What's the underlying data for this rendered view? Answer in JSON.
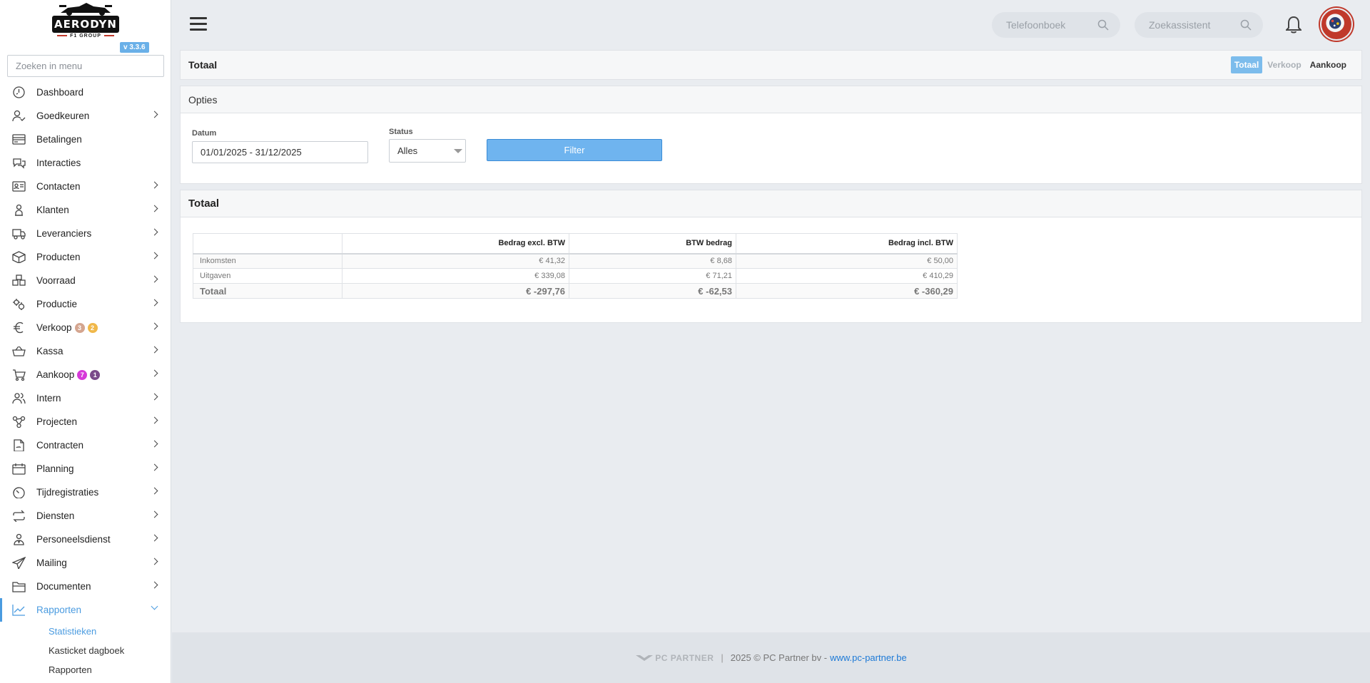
{
  "app": {
    "logo_text": "AERODYN",
    "logo_sub": "F1 GROUP",
    "version": "v 3.3.6"
  },
  "sidebar": {
    "search_placeholder": "Zoeken in menu",
    "items": [
      {
        "label": "Dashboard",
        "icon": "dashboard-icon",
        "chevron": false
      },
      {
        "label": "Goedkeuren",
        "icon": "user-check-icon",
        "chevron": true
      },
      {
        "label": "Betalingen",
        "icon": "credit-card-icon",
        "chevron": false
      },
      {
        "label": "Interacties",
        "icon": "chat-bubbles-icon",
        "chevron": false
      },
      {
        "label": "Contacten",
        "icon": "contact-card-icon",
        "chevron": true
      },
      {
        "label": "Klanten",
        "icon": "person-icon",
        "chevron": true
      },
      {
        "label": "Leveranciers",
        "icon": "truck-icon",
        "chevron": true
      },
      {
        "label": "Producten",
        "icon": "box-icon",
        "chevron": true
      },
      {
        "label": "Voorraad",
        "icon": "boxes-icon",
        "chevron": true
      },
      {
        "label": "Productie",
        "icon": "gears-icon",
        "chevron": true
      },
      {
        "label": "Verkoop",
        "icon": "euro-icon",
        "chevron": true,
        "badges": [
          {
            "value": "3",
            "color": "#d4a58f"
          },
          {
            "value": "2",
            "color": "#f0b84a"
          }
        ]
      },
      {
        "label": "Kassa",
        "icon": "basket-icon",
        "chevron": true
      },
      {
        "label": "Aankoop",
        "icon": "cart-icon",
        "chevron": true,
        "badges": [
          {
            "value": "7",
            "color": "#d63ad9"
          },
          {
            "value": "1",
            "color": "#7a4a8a"
          }
        ]
      },
      {
        "label": "Intern",
        "icon": "users-icon",
        "chevron": true
      },
      {
        "label": "Projecten",
        "icon": "project-nodes-icon",
        "chevron": true
      },
      {
        "label": "Contracten",
        "icon": "contract-icon",
        "chevron": true
      },
      {
        "label": "Planning",
        "icon": "calendar-icon",
        "chevron": true
      },
      {
        "label": "Tijdregistraties",
        "icon": "timer-icon",
        "chevron": true
      },
      {
        "label": "Diensten",
        "icon": "repeat-icon",
        "chevron": true
      },
      {
        "label": "Personeelsdienst",
        "icon": "staff-icon",
        "chevron": true
      },
      {
        "label": "Mailing",
        "icon": "paper-plane-icon",
        "chevron": true
      },
      {
        "label": "Documenten",
        "icon": "folder-icon",
        "chevron": true
      },
      {
        "label": "Rapporten",
        "icon": "line-chart-icon",
        "chevron": true,
        "active": true
      }
    ],
    "submenu": [
      {
        "label": "Statistieken",
        "active": true
      },
      {
        "label": "Kasticket dagboek",
        "active": false
      },
      {
        "label": "Rapporten",
        "active": false
      }
    ]
  },
  "topbar": {
    "phonebook_placeholder": "Telefoonboek",
    "assistant_placeholder": "Zoekassistent"
  },
  "header_panel": {
    "title": "Totaal",
    "tabs": [
      "Totaal",
      "Verkoop",
      "Aankoop"
    ],
    "selected_tab": "Totaal"
  },
  "options_panel": {
    "title": "Opties",
    "date_label": "Datum",
    "date_value": "01/01/2025 - 31/12/2025",
    "status_label": "Status",
    "status_value": "Alles",
    "filter_label": "Filter"
  },
  "totals_panel": {
    "title": "Totaal",
    "columns": [
      "",
      "Bedrag excl. BTW",
      "BTW bedrag",
      "Bedrag incl. BTW"
    ],
    "rows": [
      {
        "label": "Inkomsten",
        "excl": "€ 41,32",
        "btw": "€ 8,68",
        "incl": "€ 50,00"
      },
      {
        "label": "Uitgaven",
        "excl": "€ 339,08",
        "btw": "€ 71,21",
        "incl": "€ 410,29"
      }
    ],
    "total": {
      "label": "Totaal",
      "excl": "€ -297,76",
      "btw": "€ -62,53",
      "incl": "€ -360,29"
    }
  },
  "footer": {
    "logo_text": "PC PARTNER",
    "copyright": "2025 © PC Partner bv -",
    "link": "www.pc-partner.be"
  },
  "colors": {
    "accent": "#4a9be0",
    "filter_button": "#6fb4ef",
    "link": "#1e7ad6"
  }
}
